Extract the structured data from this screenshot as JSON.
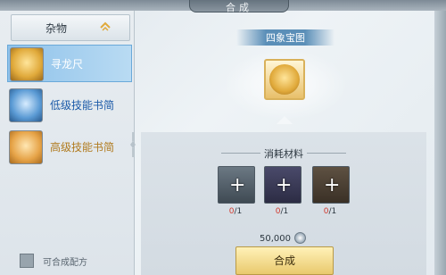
{
  "window": {
    "title": "合成"
  },
  "sidebar": {
    "category": {
      "label": "杂物"
    },
    "items": [
      {
        "label": "寻龙尺",
        "color": "#ffffff",
        "icon": "dragon-ruler-icon",
        "selected": true
      },
      {
        "label": "低级技能书简",
        "color": "#1b5aa8",
        "icon": "blue-scroll-icon",
        "selected": false
      },
      {
        "label": "高级技能书简",
        "color": "#b07a1e",
        "icon": "gold-scroll-icon",
        "selected": false
      }
    ],
    "filter_label": "可合成配方"
  },
  "result": {
    "name": "四象宝图",
    "icon": "treasure-map-icon"
  },
  "materials": {
    "title": "消耗材料",
    "slots": [
      {
        "icon": "scroll-material-icon",
        "owned": "0",
        "needed": "/1"
      },
      {
        "icon": "cloth-material-icon",
        "owned": "0",
        "needed": "/1"
      },
      {
        "icon": "tablet-material-icon",
        "owned": "0",
        "needed": "/1"
      }
    ]
  },
  "cost": {
    "amount": "50,000",
    "icon": "silver-coin-icon"
  },
  "actions": {
    "craft_label": "合成"
  }
}
